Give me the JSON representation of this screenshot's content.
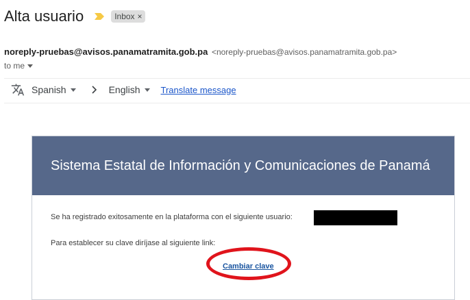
{
  "email": {
    "subject": "Alta usuario",
    "label": "Inbox",
    "label_close": "×",
    "sender_name": "noreply-pruebas@avisos.panamatramita.gob.pa",
    "sender_email": "<noreply-pruebas@avisos.panamatramita.gob.pa>",
    "recipient": "to me"
  },
  "translate": {
    "from_language": "Spanish",
    "to_language": "English",
    "link": "Translate message"
  },
  "message": {
    "header_title": "Sistema Estatal de Información y Comunicaciones de Panamá",
    "registered_text": "Se ha registrado exitosamente en la plataforma con el siguiente usuario:",
    "instruction_text": "Para establecer su clave diríjase al siguiente link:",
    "link_text": "Cambiar clave"
  },
  "colors": {
    "importance_marker": "#f6c945",
    "header_background": "#56688a",
    "annotation_circle": "#e0141c",
    "link": "#1a55a0"
  },
  "icons": {
    "importance": "label-important-icon",
    "translate": "translate-icon",
    "arrow": "chevron-right-icon"
  }
}
